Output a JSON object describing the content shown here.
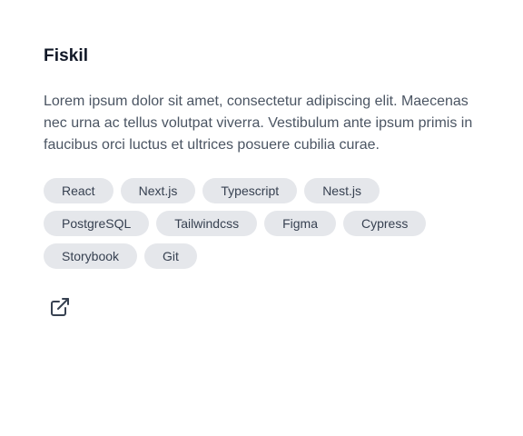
{
  "project": {
    "title": "Fiskil",
    "description": "Lorem ipsum dolor sit amet, consectetur adipiscing elit. Maecenas nec urna ac tellus volutpat viverra. Vestibulum ante ipsum primis in faucibus orci luctus et ultrices posuere cubilia curae.",
    "tags": [
      "React",
      "Next.js",
      "Typescript",
      "Nest.js",
      "PostgreSQL",
      "Tailwindcss",
      "Figma",
      "Cypress",
      "Storybook",
      "Git"
    ],
    "link_icon": "external-link-icon"
  },
  "colors": {
    "title": "#111827",
    "text": "#4b5563",
    "tag_bg": "#e5e7eb",
    "tag_text": "#374151",
    "icon": "#374151"
  }
}
